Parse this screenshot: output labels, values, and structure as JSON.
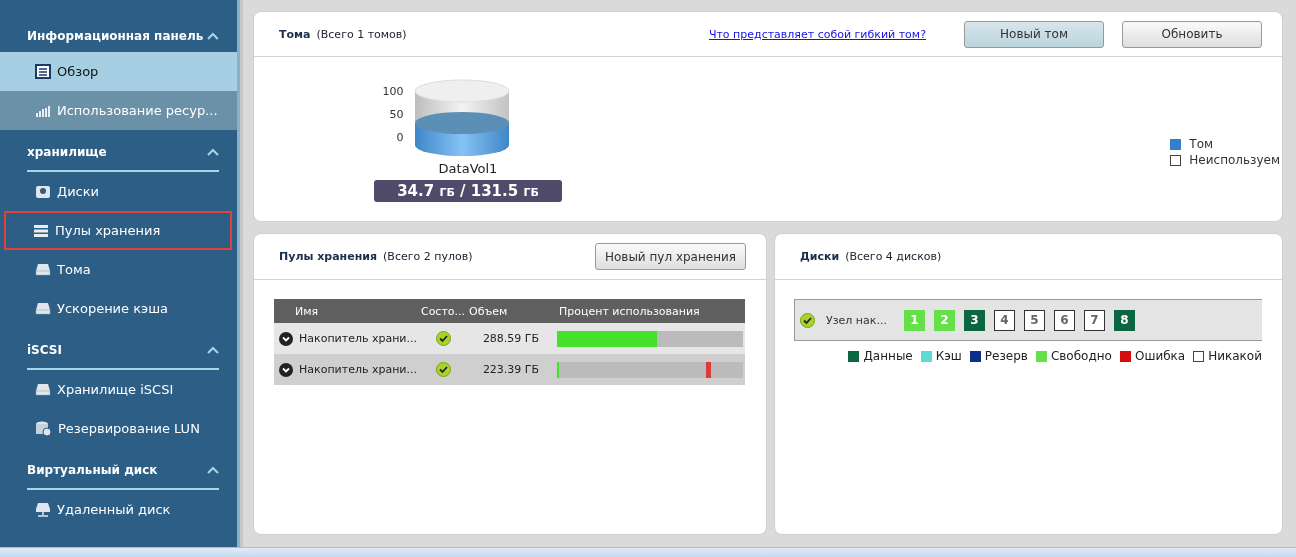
{
  "sidebar": {
    "groups": [
      {
        "title": "Информационная панель",
        "expanded": true,
        "divider": false,
        "items": [
          {
            "label": "Обзор",
            "selected": true,
            "hovered": false,
            "highlighted": false
          },
          {
            "label": "Использование ресур...",
            "selected": false,
            "hovered": true,
            "highlighted": false
          }
        ]
      },
      {
        "title": "хранилище",
        "expanded": true,
        "divider": true,
        "items": [
          {
            "label": "Диски",
            "selected": false,
            "hovered": false,
            "highlighted": false
          },
          {
            "label": "Пулы хранения",
            "selected": false,
            "hovered": false,
            "highlighted": true
          },
          {
            "label": "Тома",
            "selected": false,
            "hovered": false,
            "highlighted": false
          },
          {
            "label": "Ускорение кэша",
            "selected": false,
            "hovered": false,
            "highlighted": false
          }
        ]
      },
      {
        "title": "iSCSI",
        "expanded": true,
        "divider": true,
        "items": [
          {
            "label": "Хранилище iSCSI",
            "selected": false,
            "hovered": false,
            "highlighted": false
          },
          {
            "label": "Резервирование LUN",
            "selected": false,
            "hovered": false,
            "highlighted": false
          }
        ]
      },
      {
        "title": "Виртуальный диск",
        "expanded": true,
        "divider": true,
        "items": [
          {
            "label": "Удаленный диск",
            "selected": false,
            "hovered": false,
            "highlighted": false
          }
        ]
      }
    ]
  },
  "volumes": {
    "title": "Тома",
    "count": "(Всего 1 томов)",
    "link": "Что представляет собой гибкий том?",
    "buttons": [
      {
        "label": "Новый том",
        "primary": true
      },
      {
        "label": "Обновить",
        "primary": false
      }
    ],
    "axis_labels": [
      "100",
      "50",
      "0"
    ],
    "volume": {
      "name": "DataVol1",
      "level": 0.45,
      "used": "34.7",
      "used_unit": "ГБ",
      "separator": "/",
      "total": "131.5",
      "total_unit": "ГБ"
    },
    "legend": [
      {
        "label": "Том",
        "color": "#3380cc"
      },
      {
        "label": "Неиспользуем",
        "color": "#ffffff"
      }
    ]
  },
  "pools": {
    "title": "Пулы хранения",
    "count": "(Всего 2 пулов)",
    "button": "Новый пул хранения",
    "columns": [
      "Имя",
      "Состо...",
      "Объем",
      "Процент использования"
    ],
    "rows": [
      {
        "name": "Накопитель храни...",
        "healthy": true,
        "size": "288.59 ГБ",
        "level": 0.54,
        "alert": false
      },
      {
        "name": "Накопитель храни...",
        "healthy": true,
        "size": "223.39 ГБ",
        "level": 0.01,
        "alert": true
      }
    ]
  },
  "disks": {
    "title": "Диски",
    "count": "(Всего 4 дисков)",
    "enclosure": {
      "healthy": true,
      "name": "Узел нак...",
      "bays": [
        {
          "label": "1",
          "color": "#66e04a"
        },
        {
          "label": "2",
          "color": "#66e04a"
        },
        {
          "label": "3",
          "color": "#0b6641"
        },
        {
          "label": "4",
          "color": "#ffffff"
        },
        {
          "label": "5",
          "color": "#ffffff"
        },
        {
          "label": "6",
          "color": "#ffffff"
        },
        {
          "label": "7",
          "color": "#ffffff"
        },
        {
          "label": "8",
          "color": "#0b6641"
        }
      ]
    },
    "legend": [
      {
        "label": "Данные",
        "color": "#0b6641"
      },
      {
        "label": "Кэш",
        "color": "#5cdcd2"
      },
      {
        "label": "Резерв",
        "color": "#0a2f8f"
      },
      {
        "label": "Свободно",
        "color": "#66e04a"
      },
      {
        "label": "Ошибка",
        "color": "#d80c0c"
      },
      {
        "label": "Никакой",
        "color": "#ffffff"
      }
    ]
  }
}
